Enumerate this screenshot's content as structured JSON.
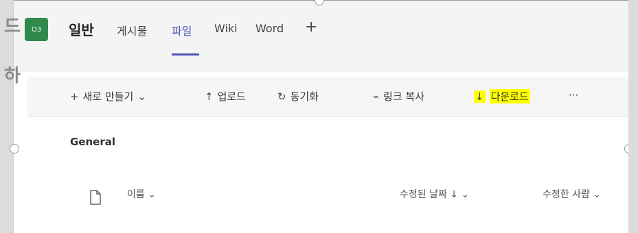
{
  "team": {
    "badge": "O3",
    "channel": "일반"
  },
  "tabs": [
    {
      "label": "게시물",
      "active": false
    },
    {
      "label": "파일",
      "active": true
    },
    {
      "label": "Wiki",
      "active": false
    },
    {
      "label": "Word",
      "active": false
    }
  ],
  "add_tab_label": "+",
  "toolbar": {
    "new_label": "새로 만들기",
    "upload_label": "업로드",
    "sync_label": "동기화",
    "copy_link_label": "링크 복사",
    "download_label": "다운로드",
    "more_label": "···"
  },
  "folder": {
    "title": "General"
  },
  "columns": {
    "name": "이름",
    "modified": "수정된 날짜 ↓",
    "modified_by": "수정한 사람"
  },
  "left_glyphs": [
    "드",
    "하"
  ],
  "colors": {
    "accent": "#4b53bc",
    "team_badge": "#2f8a4b",
    "highlight": "#ffff00"
  }
}
